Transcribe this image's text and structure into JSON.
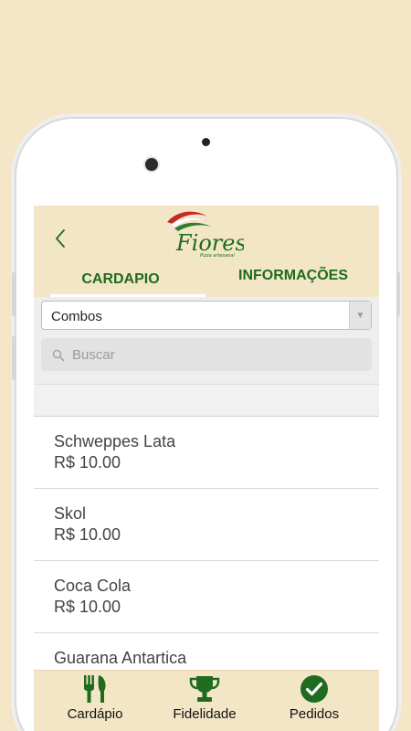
{
  "header": {
    "logo_text": "Fioresi",
    "logo_tagline": "Pizza artesanal",
    "tabs": [
      {
        "label": "CARDAPIO",
        "active": true
      },
      {
        "label": "INFORMAÇÕES",
        "active": false
      }
    ]
  },
  "filter": {
    "selected_category": "Combos",
    "search_placeholder": "Buscar"
  },
  "menu_items": [
    {
      "name": "Schweppes Lata",
      "price": "R$ 10.00"
    },
    {
      "name": "Skol",
      "price": "R$ 10.00"
    },
    {
      "name": "Coca Cola",
      "price": "R$ 10.00"
    },
    {
      "name": "Guarana Antartica",
      "price": ""
    }
  ],
  "bottom_nav": [
    {
      "label": "Cardápio",
      "icon": "cutlery-icon"
    },
    {
      "label": "Fidelidade",
      "icon": "trophy-icon"
    },
    {
      "label": "Pedidos",
      "icon": "check-circle-icon"
    }
  ],
  "colors": {
    "background": "#f5e6c8",
    "header": "#f3e6c6",
    "accent_green": "#1f6b1f",
    "accent_red": "#c62828"
  }
}
